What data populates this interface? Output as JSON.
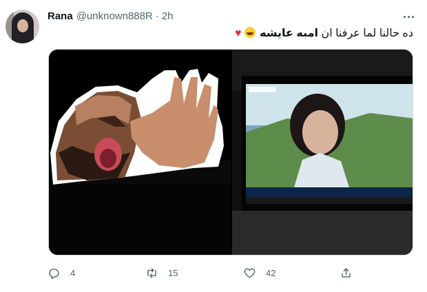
{
  "tweet": {
    "author_name": "Rana",
    "author_handle": "@unknown888R",
    "separator": "·",
    "time": "2h",
    "text_part1": "ده حالنا لما عرفنا ان ",
    "text_bold": "امبه عايشه",
    "actions": {
      "replies": "4",
      "retweets": "15",
      "likes": "42"
    }
  },
  "icons": {
    "avatar": "avatar",
    "more": "more-horizontal-icon",
    "reply": "reply-icon",
    "retweet": "retweet-icon",
    "like": "heart-icon",
    "share": "share-icon",
    "emoji_laugh": "face-with-tears-of-joy-icon",
    "emoji_heart": "red-heart-icon"
  },
  "colors": {
    "text": "#0f1419",
    "muted": "#536471",
    "border": "#cfd9de",
    "heart": "#dd2e44"
  }
}
